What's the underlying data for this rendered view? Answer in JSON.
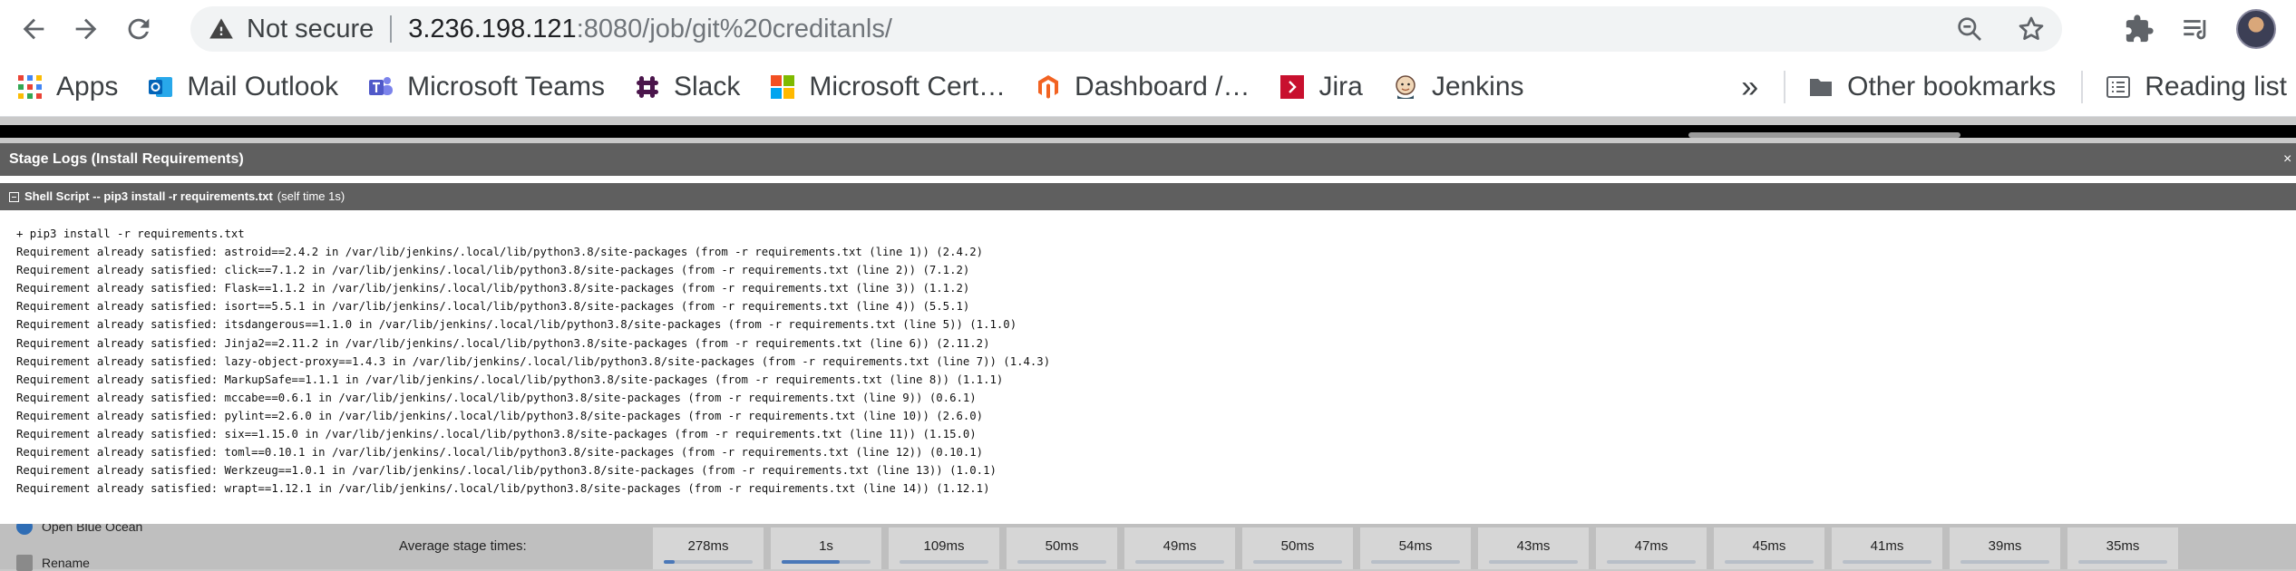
{
  "browser": {
    "security_label": "Not secure",
    "url_host": "3.236.198.121",
    "url_rest": ":8080/job/git%20creditanls/",
    "icons": [
      "back-icon",
      "forward-icon",
      "reload-icon",
      "warning-icon",
      "zoom-icon",
      "star-icon",
      "extensions-icon",
      "reading-list-icon",
      "avatar"
    ]
  },
  "bookmarks": {
    "items": [
      {
        "label": "Apps",
        "icon": "apps-grid-icon"
      },
      {
        "label": "Mail Outlook",
        "icon": "outlook-icon"
      },
      {
        "label": "Microsoft Teams",
        "icon": "teams-icon"
      },
      {
        "label": "Slack",
        "icon": "slack-icon"
      },
      {
        "label": "Microsoft Cert…",
        "icon": "microsoft-icon"
      },
      {
        "label": "Dashboard /…",
        "icon": "magento-icon"
      },
      {
        "label": "Jira",
        "icon": "jira-icon"
      },
      {
        "label": "Jenkins",
        "icon": "jenkins-icon"
      }
    ],
    "overflow": "»",
    "other": "Other bookmarks",
    "reading_list": "Reading list"
  },
  "modal": {
    "title": "Stage Logs (Install Requirements)",
    "close": "×",
    "step_name": "Shell Script -- pip3 install -r requirements.txt",
    "step_time": "(self time 1s)",
    "log": [
      "+ pip3 install -r requirements.txt",
      "Requirement already satisfied: astroid==2.4.2 in /var/lib/jenkins/.local/lib/python3.8/site-packages (from -r requirements.txt (line 1)) (2.4.2)",
      "Requirement already satisfied: click==7.1.2 in /var/lib/jenkins/.local/lib/python3.8/site-packages (from -r requirements.txt (line 2)) (7.1.2)",
      "Requirement already satisfied: Flask==1.1.2 in /var/lib/jenkins/.local/lib/python3.8/site-packages (from -r requirements.txt (line 3)) (1.1.2)",
      "Requirement already satisfied: isort==5.5.1 in /var/lib/jenkins/.local/lib/python3.8/site-packages (from -r requirements.txt (line 4)) (5.5.1)",
      "Requirement already satisfied: itsdangerous==1.1.0 in /var/lib/jenkins/.local/lib/python3.8/site-packages (from -r requirements.txt (line 5)) (1.1.0)",
      "Requirement already satisfied: Jinja2==2.11.2 in /var/lib/jenkins/.local/lib/python3.8/site-packages (from -r requirements.txt (line 6)) (2.11.2)",
      "Requirement already satisfied: lazy-object-proxy==1.4.3 in /var/lib/jenkins/.local/lib/python3.8/site-packages (from -r requirements.txt (line 7)) (1.4.3)",
      "Requirement already satisfied: MarkupSafe==1.1.1 in /var/lib/jenkins/.local/lib/python3.8/site-packages (from -r requirements.txt (line 8)) (1.1.1)",
      "Requirement already satisfied: mccabe==0.6.1 in /var/lib/jenkins/.local/lib/python3.8/site-packages (from -r requirements.txt (line 9)) (0.6.1)",
      "Requirement already satisfied: pylint==2.6.0 in /var/lib/jenkins/.local/lib/python3.8/site-packages (from -r requirements.txt (line 10)) (2.6.0)",
      "Requirement already satisfied: six==1.15.0 in /var/lib/jenkins/.local/lib/python3.8/site-packages (from -r requirements.txt (line 11)) (1.15.0)",
      "Requirement already satisfied: toml==0.10.1 in /var/lib/jenkins/.local/lib/python3.8/site-packages (from -r requirements.txt (line 12)) (0.10.1)",
      "Requirement already satisfied: Werkzeug==1.0.1 in /var/lib/jenkins/.local/lib/python3.8/site-packages (from -r requirements.txt (line 13)) (1.0.1)",
      "Requirement already satisfied: wrapt==1.12.1 in /var/lib/jenkins/.local/lib/python3.8/site-packages (from -r requirements.txt (line 14)) (1.12.1)"
    ]
  },
  "background": {
    "sidebar": [
      "Open Blue Ocean",
      "Rename"
    ],
    "avg_label": "Average stage times:",
    "stages": [
      {
        "time": "278ms",
        "fill": 0.12
      },
      {
        "time": "1s",
        "fill": 0.65
      },
      {
        "time": "109ms",
        "fill": 0.0
      },
      {
        "time": "50ms",
        "fill": 0.0
      },
      {
        "time": "49ms",
        "fill": 0.0
      },
      {
        "time": "50ms",
        "fill": 0.0
      },
      {
        "time": "54ms",
        "fill": 0.0
      },
      {
        "time": "43ms",
        "fill": 0.0
      },
      {
        "time": "47ms",
        "fill": 0.0
      },
      {
        "time": "45ms",
        "fill": 0.0
      },
      {
        "time": "41ms",
        "fill": 0.0
      },
      {
        "time": "39ms",
        "fill": 0.0
      },
      {
        "time": "35ms",
        "fill": 0.0
      }
    ]
  }
}
